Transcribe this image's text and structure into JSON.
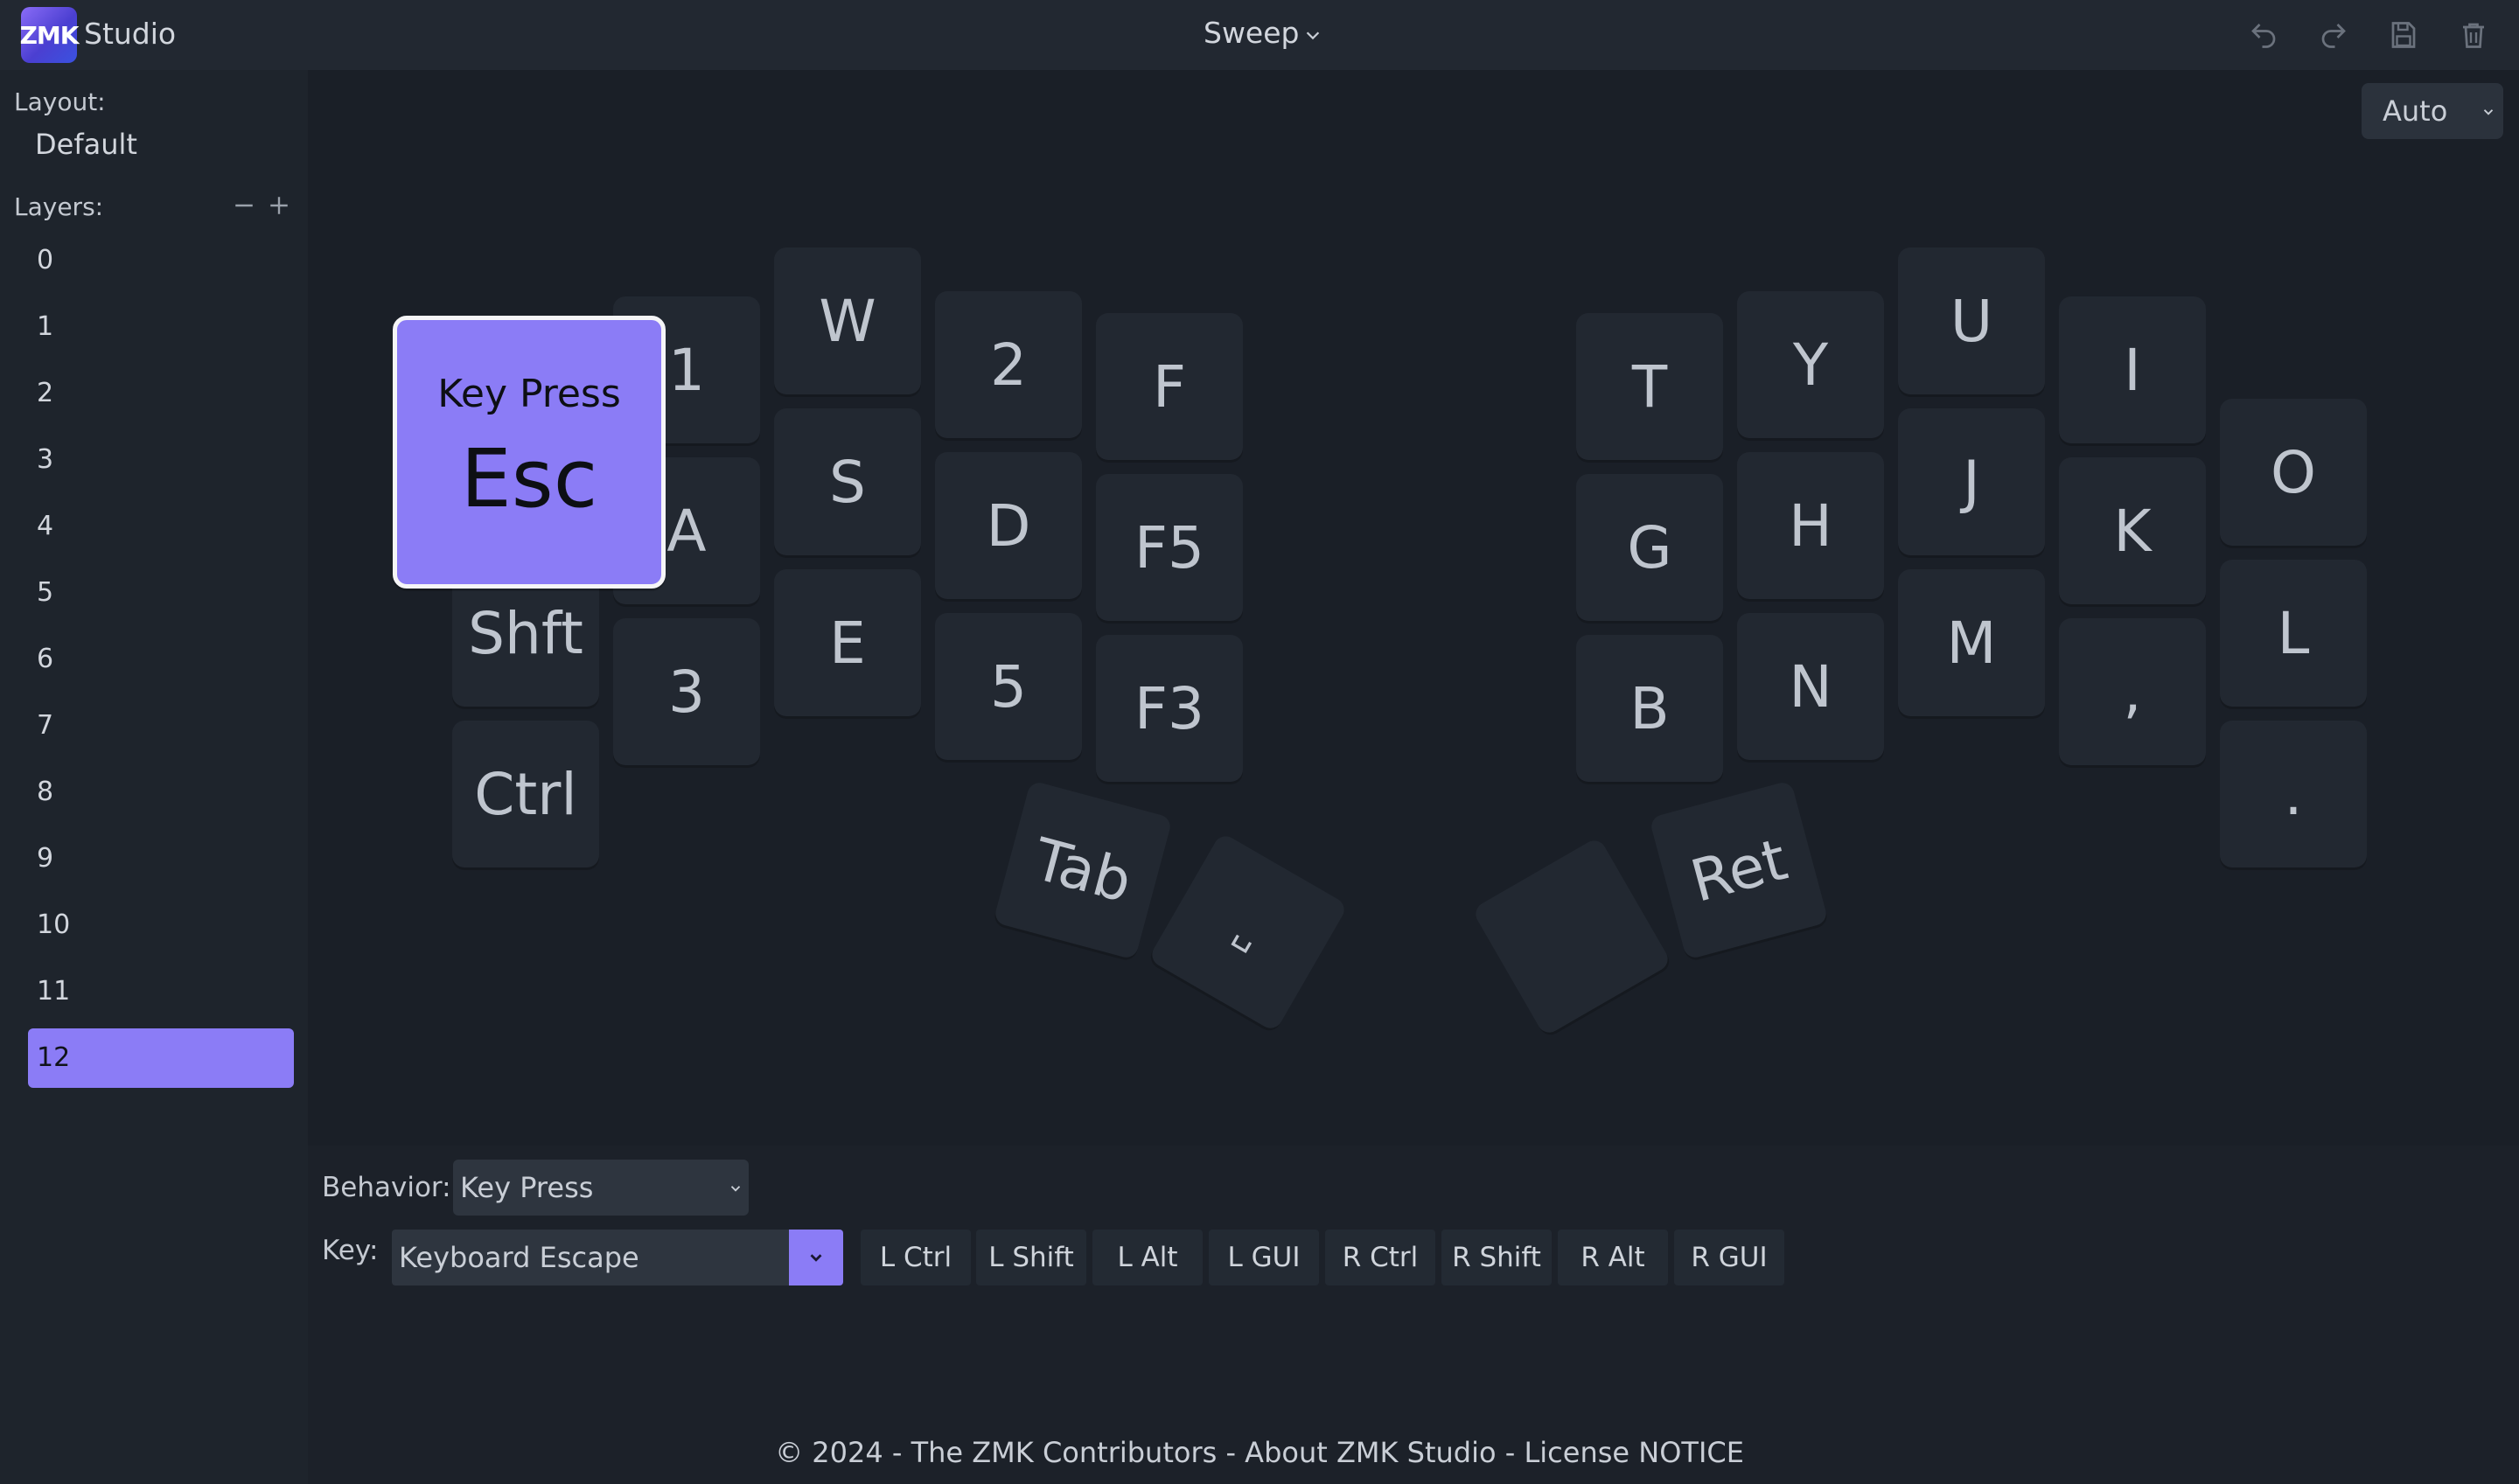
{
  "header": {
    "logo_text": "ZMK",
    "app_name": "Studio",
    "keyboard_name": "Sweep",
    "icons": [
      "undo-icon",
      "redo-icon",
      "save-icon",
      "trash-icon"
    ]
  },
  "sidebar": {
    "layout_label": "Layout:",
    "layout_value": "Default",
    "layers_label": "Layers:",
    "layers": [
      "0",
      "1",
      "2",
      "3",
      "4",
      "5",
      "6",
      "7",
      "8",
      "9",
      "10",
      "11",
      "12"
    ],
    "active_layer": "12"
  },
  "canvas": {
    "zoom_select": "Auto",
    "selected_key": {
      "behavior": "Key Press",
      "label": "Esc"
    },
    "keys": {
      "k1": "1",
      "w": "W",
      "k2": "2",
      "f": "F",
      "a": "A",
      "s": "S",
      "d": "D",
      "f5": "F5",
      "shft": "Shft",
      "k3": "3",
      "e": "E",
      "k5": "5",
      "f3": "F3",
      "ctrl": "Ctrl",
      "t": "T",
      "y": "Y",
      "u": "U",
      "i": "I",
      "g": "G",
      "h": "H",
      "j": "J",
      "k": "K",
      "o": "O",
      "b": "B",
      "n": "N",
      "m": "M",
      "comma": ",",
      "l": "L",
      "dot": ".",
      "tab": "Tab",
      "space": "␣",
      "ret": "Ret",
      "blank": ""
    }
  },
  "editor": {
    "behavior_label": "Behavior:",
    "behavior_value": "Key Press",
    "key_label": "Key:",
    "key_value": "Keyboard Escape",
    "modifiers": [
      "L Ctrl",
      "L Shift",
      "L Alt",
      "L GUI",
      "R Ctrl",
      "R Shift",
      "R Alt",
      "R GUI"
    ]
  },
  "footer": {
    "text": "© 2024 - The ZMK Contributors - About ZMK Studio - License NOTICE"
  },
  "colors": {
    "accent": "#8b7cf6",
    "background": "#1c2129",
    "key": "#222831"
  }
}
